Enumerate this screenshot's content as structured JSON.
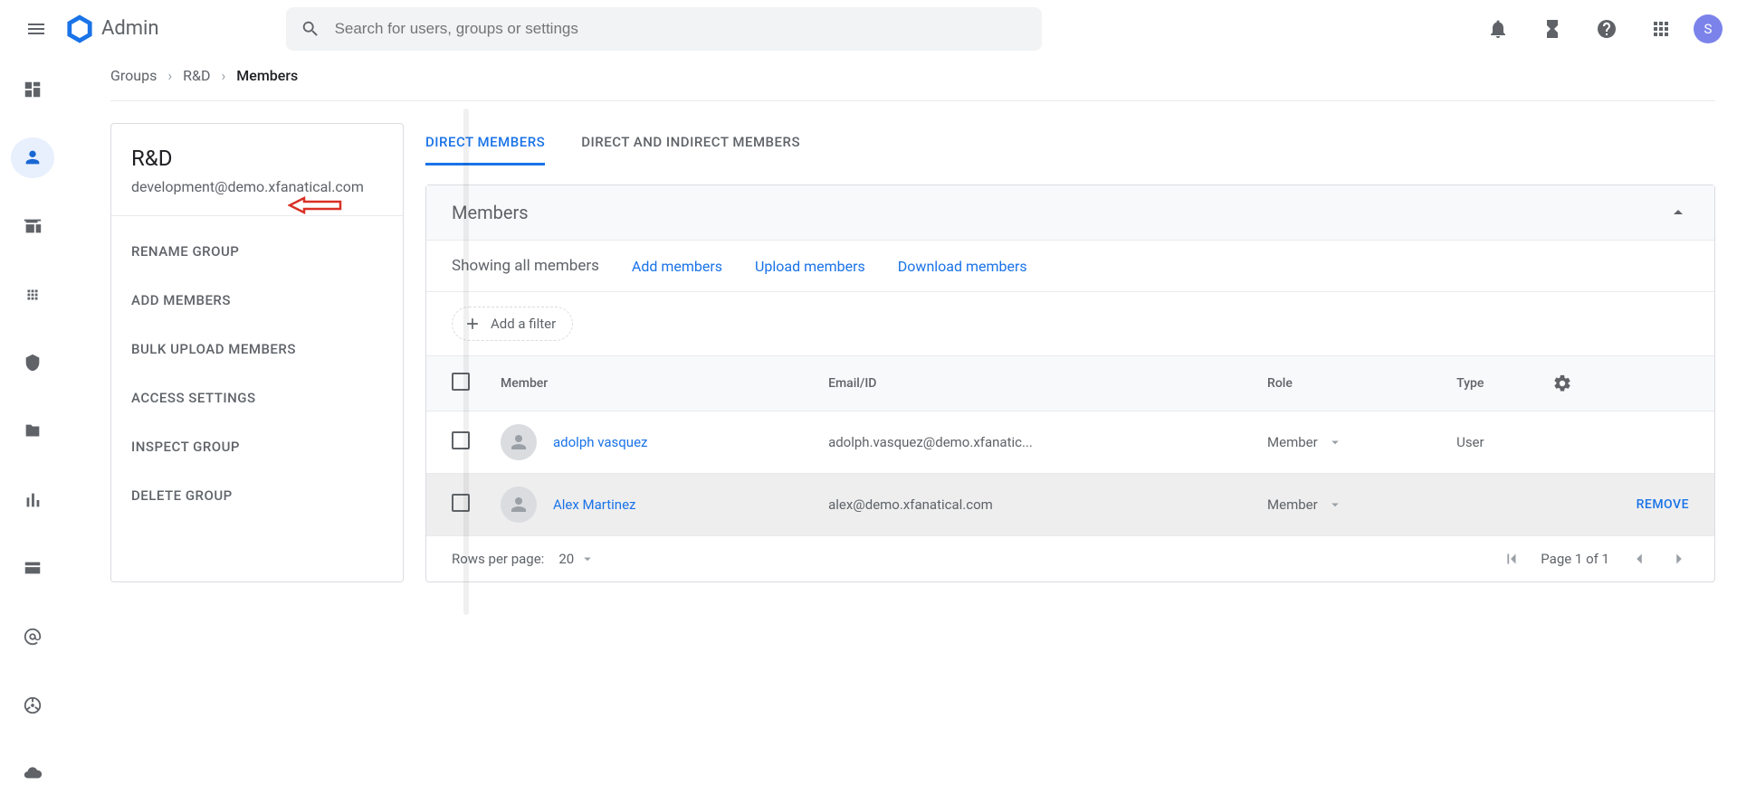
{
  "header": {
    "app_name": "Admin",
    "search_placeholder": "Search for users, groups or settings",
    "avatar_initial": "S"
  },
  "breadcrumb": {
    "items": [
      "Groups",
      "R&D",
      "Members"
    ]
  },
  "sidebar_card": {
    "group_name": "R&D",
    "group_email": "development@demo.xfanatical.com",
    "actions": [
      "RENAME GROUP",
      "ADD MEMBERS",
      "BULK UPLOAD MEMBERS",
      "ACCESS SETTINGS",
      "INSPECT GROUP",
      "DELETE GROUP"
    ]
  },
  "tabs": {
    "items": [
      "DIRECT MEMBERS",
      "DIRECT AND INDIRECT MEMBERS"
    ],
    "active_index": 0
  },
  "members_panel": {
    "title": "Members",
    "showing_text": "Showing all members",
    "links": [
      "Add members",
      "Upload members",
      "Download members"
    ],
    "add_filter_label": "Add a filter",
    "columns": [
      "Member",
      "Email/ID",
      "Role",
      "Type"
    ],
    "rows": [
      {
        "name": "adolph vasquez",
        "email": "adolph.vasquez@demo.xfanatic...",
        "role": "Member",
        "type": "User",
        "hovered": false
      },
      {
        "name": "Alex Martinez",
        "email": "alex@demo.xfanatical.com",
        "role": "Member",
        "type": "",
        "hovered": true,
        "remove_label": "REMOVE"
      }
    ]
  },
  "pagination": {
    "rows_per_page_label": "Rows per page:",
    "rows_per_page_value": "20",
    "page_text": "Page 1 of 1"
  }
}
